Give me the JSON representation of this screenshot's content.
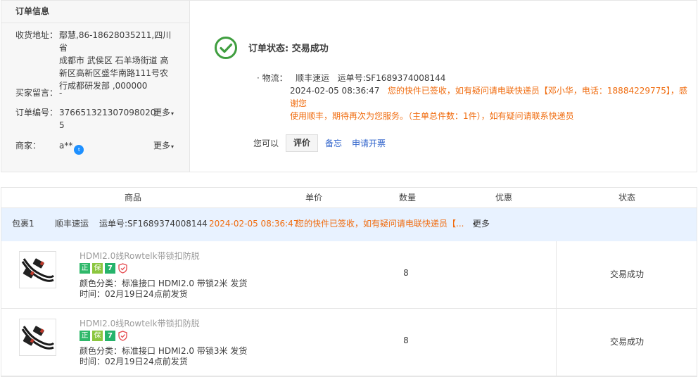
{
  "order_info": {
    "title": "订单信息",
    "address_label": "收货地址：",
    "address_lines": [
      "鄢慧,86-18628035211,四川省",
      "成都市 武侯区 石羊场街道 高",
      "新区高新区盛华南路111号农",
      "行成都研发部 ,000000"
    ],
    "buyer_msg_label": "买家留言：",
    "buyer_msg_value": "-",
    "order_no_label": "订单编号：",
    "order_no_lines": [
      "376651321307098020",
      "5"
    ],
    "merchant_label": "商家：",
    "merchant_value": "a**",
    "more_label": "更多",
    "ww_icon_text": "t"
  },
  "status": {
    "icon": "check-circle-icon",
    "title": "订单状态: 交易成功",
    "logistics_label": "· 物流：",
    "carrier": "顺丰速运",
    "tracking": "运单号:SF1689374008144",
    "time": "2024-02-05 08:36:47",
    "message_line1": "您的快件已签收，如有疑问请电联快递员【邓小华，电话：18884229775】，感谢您",
    "message_line2": "使用顺丰，期待再次为您服务。（主单总件数：1件），如有疑问请联系快递员"
  },
  "actions": {
    "prompt": "您可以",
    "rate": "评价",
    "note": "备忘",
    "invoice": "申请开票"
  },
  "table": {
    "headers": [
      "商品",
      "单价",
      "数量",
      "优惠",
      "状态"
    ],
    "package": {
      "name": "包裹1",
      "carrier": "顺丰速运",
      "tracking": "运单号:SF1689374008144",
      "time": "2024-02-05 08:36:47",
      "message": "您的快件已签收，如有疑问请电联快递员【...",
      "more": "更多"
    },
    "rows": [
      {
        "name": "HDMI2.0线Rowtelk带锁扣防脱",
        "spec": "颜色分类：标准接口 HDMI2.0 带锁2米 发货",
        "time": "时间：02月19日24点前发货",
        "qty": "8",
        "status": "交易成功"
      },
      {
        "name": "HDMI2.0线Rowtelk带锁扣防脱",
        "spec": "颜色分类：标准接口 HDMI2.0 带锁3米 发货",
        "time": "时间：02月19日24点前发货",
        "qty": "8",
        "status": "交易成功"
      }
    ],
    "badges": [
      "正",
      "保",
      "7"
    ]
  },
  "colors": {
    "accent_orange": "#f06c0f",
    "link_blue": "#3366cc",
    "success_green": "#3f9e3f",
    "package_bg": "#e8f2ff"
  }
}
